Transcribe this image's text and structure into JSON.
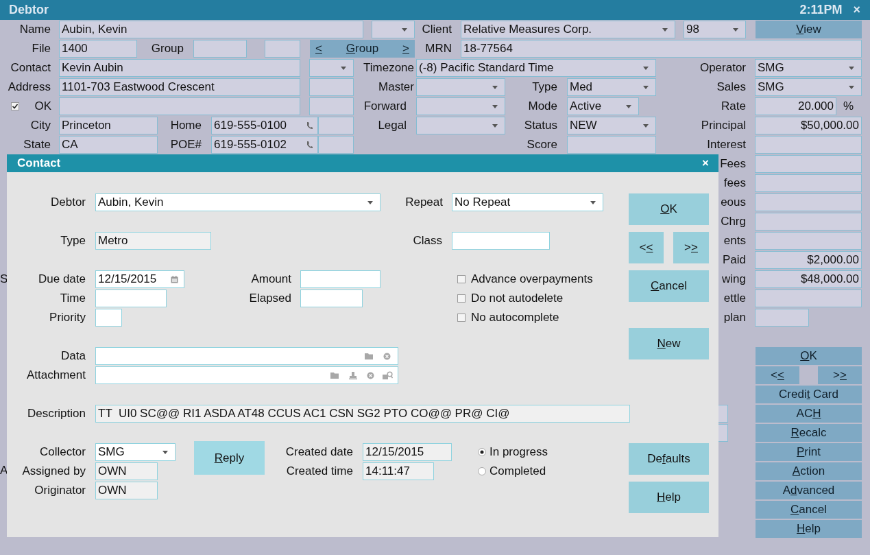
{
  "window": {
    "title": "Debtor",
    "time": "2:11PM",
    "close_glyph": "×"
  },
  "debtor_form": {
    "name": {
      "label": "Name",
      "value": "Aubin, Kevin"
    },
    "client": {
      "label": "Client",
      "value": "Relative Measures Corp.",
      "number": "98"
    },
    "view_button": {
      "key": "V",
      "after": "iew"
    },
    "file": {
      "label": "File",
      "value": "1400"
    },
    "group": {
      "label": "Group"
    },
    "group_nav": {
      "prev": {
        "key": "<"
      },
      "label": {
        "key": "G",
        "after": "roup"
      },
      "next": {
        "key": ">"
      }
    },
    "mrn": {
      "label": "MRN",
      "value": "18-77564"
    },
    "contact": {
      "label": "Contact",
      "value": "Kevin Aubin"
    },
    "timezone": {
      "label": "Timezone",
      "value": "(-8) Pacific Standard Time"
    },
    "operator": {
      "label": "Operator",
      "value": "SMG"
    },
    "address": {
      "label": "Address",
      "value": "1101-703 Eastwood Crescent"
    },
    "master": {
      "label": "Master"
    },
    "type": {
      "label": "Type",
      "value": "Med"
    },
    "sales": {
      "label": "Sales",
      "value": "SMG"
    },
    "ok": {
      "label": "OK",
      "checked": true
    },
    "forward": {
      "label": "Forward"
    },
    "mode": {
      "label": "Mode",
      "value": "Active"
    },
    "rate": {
      "label": "Rate",
      "value": "20.000",
      "unit": "%"
    },
    "city": {
      "label": "City",
      "value": "Princeton"
    },
    "home": {
      "label": "Home",
      "value": "619-555-0100"
    },
    "legal": {
      "label": "Legal"
    },
    "status": {
      "label": "Status",
      "value": "NEW"
    },
    "principal": {
      "label": "Principal",
      "value": "$50,000.00"
    },
    "state": {
      "label": "State",
      "value": "CA"
    },
    "poe": {
      "label": "POE#",
      "value": "619-555-0102"
    },
    "score": {
      "label": "Score"
    },
    "interest": {
      "label": "Interest"
    },
    "amounts": [
      {
        "label": "Fees"
      },
      {
        "label": "fees"
      },
      {
        "label": "eous"
      },
      {
        "label": "Chrg"
      },
      {
        "label": "ents"
      },
      {
        "label": "Paid",
        "value": "$2,000.00"
      },
      {
        "label": "wing",
        "value": "$48,000.00"
      },
      {
        "label": "ettle"
      },
      {
        "label": "plan"
      }
    ],
    "cut_labels": [
      "S",
      "A"
    ]
  },
  "side_buttons": [
    {
      "key": "O",
      "after": "K"
    },
    {
      "before": "<",
      "key": "<"
    },
    {
      "before": ">",
      "key": ">"
    },
    {
      "before": "Credi",
      "key": "t",
      "after": " Card"
    },
    {
      "before": "AC",
      "key": "H"
    },
    {
      "key": "R",
      "after": "ecalc"
    },
    {
      "key": "P",
      "after": "rint"
    },
    {
      "key": "A",
      "after": "ction"
    },
    {
      "before": "A",
      "key": "d",
      "after": "vanced"
    },
    {
      "key": "C",
      "after": "ancel"
    },
    {
      "key": "H",
      "after": "elp"
    }
  ],
  "contact_dialog": {
    "title": "Contact",
    "close_glyph": "×",
    "debtor": {
      "label": "Debtor",
      "value": "Aubin, Kevin"
    },
    "repeat": {
      "label": "Repeat",
      "value": "No Repeat"
    },
    "type": {
      "label": "Type",
      "value": "Metro"
    },
    "class": {
      "label": "Class"
    },
    "due_date": {
      "label": "Due date",
      "value": "12/15/2015"
    },
    "amount": {
      "label": "Amount"
    },
    "time": {
      "label": "Time"
    },
    "elapsed": {
      "label": "Elapsed"
    },
    "priority": {
      "label": "Priority"
    },
    "options": [
      {
        "label": "Advance overpayments",
        "checked": false
      },
      {
        "label": "Do not autodelete",
        "checked": false
      },
      {
        "label": "No autocomplete",
        "checked": false
      }
    ],
    "data": {
      "label": "Data"
    },
    "attachment": {
      "label": "Attachment"
    },
    "description": {
      "label": "Description",
      "value": "TT  UI0 SC@@ RI1 ASDA AT48 CCUS AC1 CSN SG2 PTO CO@@ PR@ CI@"
    },
    "collector": {
      "label": "Collector",
      "value": "SMG"
    },
    "assigned_by": {
      "label": "Assigned by",
      "value": "OWN"
    },
    "originator": {
      "label": "Originator",
      "value": "OWN"
    },
    "created_date": {
      "label": "Created date",
      "value": "12/15/2015"
    },
    "created_time": {
      "label": "Created time",
      "value": "14:11:47"
    },
    "progress": [
      {
        "label": "In progress",
        "selected": true
      },
      {
        "label": "Completed",
        "selected": false
      }
    ],
    "buttons": {
      "ok": {
        "key": "O",
        "after": "K"
      },
      "prev": {
        "before": "<",
        "key": "<"
      },
      "next": {
        "before": ">",
        "key": ">"
      },
      "cancel": {
        "key": "C",
        "after": "ancel"
      },
      "new": {
        "key": "N",
        "after": "ew"
      },
      "reply": {
        "key": "R",
        "after": "eply"
      },
      "defaults": {
        "before": "De",
        "key": "f",
        "after": "aults"
      },
      "help": {
        "key": "H",
        "after": "elp"
      }
    }
  }
}
